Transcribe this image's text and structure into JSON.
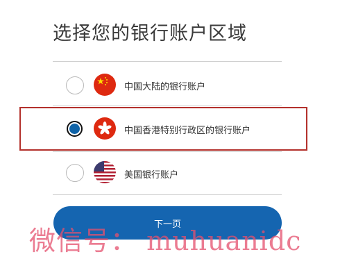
{
  "title": "选择您的银行账户区域",
  "options": [
    {
      "label": "中国大陆的银行账户",
      "flag": "china-flag",
      "selected": false
    },
    {
      "label": "中国香港特别行政区的银行账户",
      "flag": "hong-kong-flag",
      "selected": true
    },
    {
      "label": "美国银行账户",
      "flag": "usa-flag",
      "selected": false
    }
  ],
  "next_button": "下一页",
  "watermark": "微信号： muhuanidc",
  "colors": {
    "accent": "#1565b0",
    "highlight_border": "#b3312c",
    "watermark": "#e4506e"
  }
}
